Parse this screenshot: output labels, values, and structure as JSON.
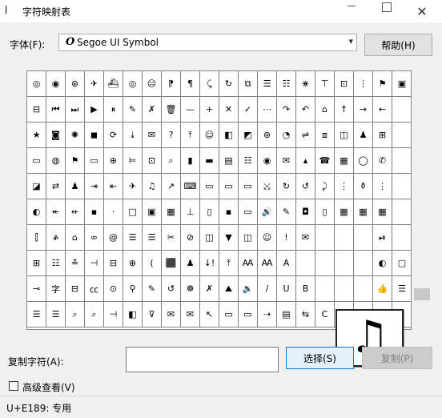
{
  "window": {
    "title": "字符映射表",
    "app_icon": "charmap-icon",
    "min_icon": "minimize-icon",
    "max_icon": "maximize-icon",
    "close_icon": "close-icon",
    "close_glyph": "✕"
  },
  "font": {
    "label": "字体(F):",
    "value": "Segoe UI Symbol",
    "font_icon_glyph": "O",
    "dropdown_glyph": "▾"
  },
  "help_button": "帮助(H)",
  "grid": {
    "rows": [
      [
        "◎",
        "◉",
        "⊛",
        "✈",
        "⛴",
        "◎",
        "☹",
        "⁋",
        "¶",
        "⤹",
        "↻",
        "⧉",
        "☰",
        "☷",
        "⋇",
        "⊤",
        "⊡",
        "⋮",
        "⚑",
        "▣"
      ],
      [
        "⊟",
        "⏮",
        "⏭",
        "▶",
        "⏸",
        "✎",
        "✗",
        "🗑",
        "—",
        "+",
        "✕",
        "✓",
        "⋯",
        "↷",
        "↶",
        "⌂",
        "↑",
        "→",
        "←",
        ""
      ],
      [
        "★",
        "◙",
        "✺",
        "◼",
        "⟳",
        "⤓",
        "✉",
        "?",
        "⤒",
        "☺",
        "◧",
        "◩",
        "⊛",
        "◔",
        "⇌",
        "⧈",
        "◫",
        "♟",
        "⊞",
        ""
      ],
      [
        "▭",
        "◍",
        "⚑",
        "▭",
        "⊕",
        "⊨",
        "⊡",
        "⌕",
        "▮",
        "▬",
        "▤",
        "☷",
        "◉",
        "✉",
        "▴",
        "☎",
        "▦",
        "◯",
        "✆",
        ""
      ],
      [
        "◪",
        "⇄",
        "♟",
        "⇥",
        "⇤",
        "✈",
        "♫",
        "↗",
        "⌨",
        "▭",
        "▭",
        "▭",
        "⤩",
        "↻",
        "↺",
        "⤸",
        "⋮",
        "⚱",
        "⋮",
        ""
      ],
      [
        "◐",
        "↞",
        "⇷",
        "▪",
        "·",
        "□",
        "▣",
        "▦",
        "⊥",
        "▯",
        "▪",
        "▭",
        "🔊",
        "✎",
        "◘",
        "▯",
        "▦",
        "▦",
        "▦",
        ""
      ],
      [
        "⫿",
        "ቆ",
        "⌂",
        "∞",
        "@",
        "☰",
        "☰",
        "✂",
        "⊘",
        "◫",
        "▼",
        "◫",
        "☺",
        "!",
        "✉",
        "",
        "",
        "",
        "⏯",
        ""
      ],
      [
        "⊞",
        "☷",
        "≚",
        "⊣",
        "⊟",
        "⊕",
        "(",
        "⬛",
        "♟",
        "↓!",
        "⤒",
        "Ꜳ",
        "Ꜳ",
        "A",
        "",
        "",
        "",
        "",
        "◐",
        "▢"
      ],
      [
        "⊸",
        "字",
        "⊟",
        "㏄",
        "⊙",
        "⚲",
        "✎",
        "↺",
        "☸",
        "✗",
        "⛰",
        "🔉",
        "/",
        "U",
        "B",
        "",
        "",
        "",
        "👍",
        "☰"
      ],
      [
        "☰",
        "☰",
        "⌕",
        "⌕",
        "⊣",
        "◧",
        "⊽",
        "✉",
        "✉",
        "↖",
        "▭",
        "▭",
        "⇢",
        "▤",
        "⇆",
        "C",
        "G",
        "S",
        "F",
        "K"
      ]
    ]
  },
  "zoom_glyph": "♫",
  "copy": {
    "label": "复制字符(A):",
    "value": "",
    "select_button": "选择(S)",
    "copy_button": "复制(P)"
  },
  "advanced": {
    "label": "高级查看(V)",
    "checked": false
  },
  "status": {
    "text": "U+E189: 专用"
  }
}
